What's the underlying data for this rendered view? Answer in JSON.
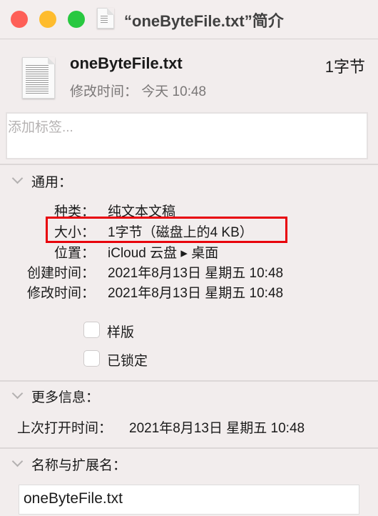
{
  "window": {
    "title": "“oneByteFile.txt”简介",
    "colors": {
      "close": "#fe5f57",
      "minimize": "#febc2e",
      "zoom": "#28c840",
      "highlight": "#e8000b"
    }
  },
  "header": {
    "file_name": "oneByteFile.txt",
    "size": "1字节",
    "modified": "修改时间： 今天 10:48"
  },
  "tags": {
    "placeholder": "添加标签..."
  },
  "general": {
    "title": "通用：",
    "rows": [
      {
        "label": "种类：",
        "value": "纯文本文稿"
      },
      {
        "label": "大小：",
        "value": "1字节（磁盘上的4 KB）"
      },
      {
        "label": "位置：",
        "value": "iCloud 云盘 ▸ 桌面"
      },
      {
        "label": "创建时间：",
        "value": "2021年8月13日 星期五 10:48"
      },
      {
        "label": "修改时间：",
        "value": "2021年8月13日 星期五 10:48"
      }
    ],
    "stationery": "样版",
    "locked": "已锁定",
    "stationery_checked": false,
    "locked_checked": false
  },
  "more_info": {
    "title": "更多信息：",
    "last_opened_label": "上次打开时间：",
    "last_opened_value": "2021年8月13日 星期五 10:48"
  },
  "name_ext": {
    "title": "名称与扩展名：",
    "value": "oneByteFile.txt"
  }
}
